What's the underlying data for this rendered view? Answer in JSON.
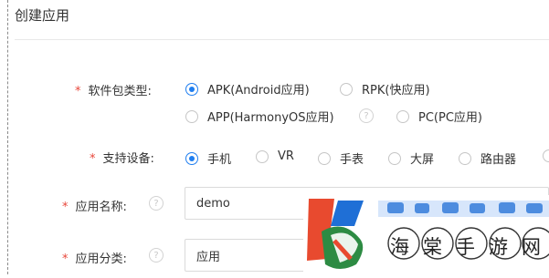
{
  "panel": {
    "title": "创建应用"
  },
  "form": {
    "required_mark": "*",
    "package_type": {
      "label": "软件包类型:",
      "options": [
        {
          "label": "APK(Android应用)",
          "checked": true
        },
        {
          "label": "RPK(快应用)",
          "checked": false
        },
        {
          "label": "APP(HarmonyOS应用)",
          "checked": false
        },
        {
          "label": "PC(PC应用)",
          "checked": false
        }
      ]
    },
    "devices": {
      "label": "支持设备:",
      "options": [
        {
          "label": "手机",
          "checked": true
        },
        {
          "label": "VR",
          "checked": false
        },
        {
          "label": "手表",
          "checked": false
        },
        {
          "label": "大屏",
          "checked": false
        },
        {
          "label": "路由器",
          "checked": false
        }
      ]
    },
    "app_name": {
      "label": "应用名称:",
      "value": "demo",
      "help": "?"
    },
    "app_category": {
      "label": "应用分类:",
      "value": "应用",
      "help": "?"
    }
  },
  "watermark": {
    "text": "海棠手游网"
  },
  "colors": {
    "accent": "#1f7ef0",
    "required": "#e8463a",
    "border": "#dadada"
  }
}
